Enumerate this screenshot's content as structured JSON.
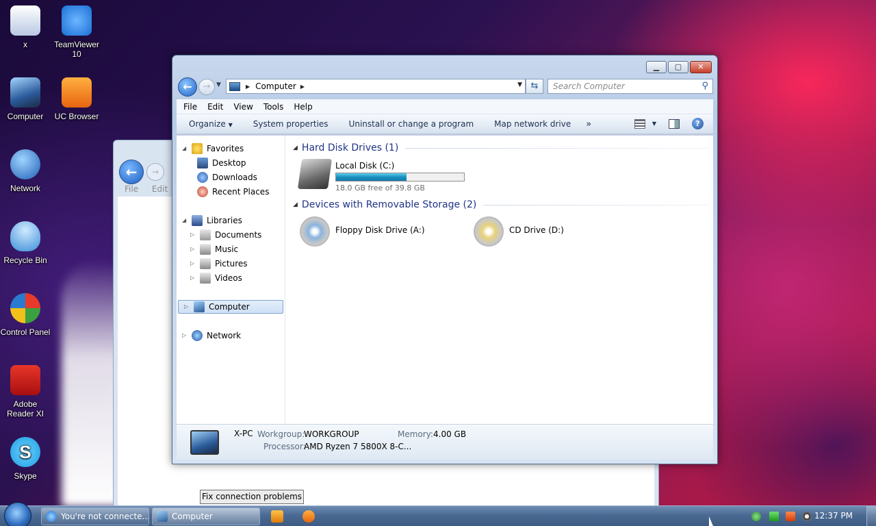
{
  "desktop": {
    "icons": [
      {
        "label": "x",
        "color": "#d5dff0"
      },
      {
        "label": "TeamViewer 10",
        "color": "#1a6fd6"
      },
      {
        "label": "Computer",
        "color": "#3a78c2"
      },
      {
        "label": "UC Browser",
        "color": "#f07a1a"
      },
      {
        "label": "Network",
        "color": "#2a7ad0"
      },
      {
        "label": "Recycle Bin",
        "color": "#5aaee8"
      },
      {
        "label": "Control Panel",
        "color": "#3aa040"
      },
      {
        "label": "Adobe Reader XI",
        "color": "#c41a1a"
      },
      {
        "label": "Skype",
        "color": "#1fa8e8"
      }
    ]
  },
  "background_window": {
    "menu": [
      "File",
      "Edit"
    ],
    "fix_button": "Fix connection problems"
  },
  "window": {
    "address": {
      "location": "Computer"
    },
    "search_placeholder": "Search Computer",
    "menu": [
      "File",
      "Edit",
      "View",
      "Tools",
      "Help"
    ],
    "commands": {
      "organize": "Organize",
      "system_properties": "System properties",
      "uninstall": "Uninstall or change a program",
      "map_drive": "Map network drive",
      "more": "»"
    },
    "nav": {
      "favorites": "Favorites",
      "desktop": "Desktop",
      "downloads": "Downloads",
      "recent": "Recent Places",
      "libraries": "Libraries",
      "documents": "Documents",
      "music": "Music",
      "pictures": "Pictures",
      "videos": "Videos",
      "computer": "Computer",
      "network": "Network"
    },
    "groups": {
      "hdd": "Hard Disk Drives (1)",
      "removable": "Devices with Removable Storage (2)"
    },
    "drives": {
      "local_c": {
        "name": "Local Disk (C:)",
        "free_text": "18.0 GB free of 39.8 GB",
        "used_fraction": 0.55
      },
      "floppy": {
        "name": "Floppy Disk Drive (A:)"
      },
      "cd": {
        "name": "CD Drive (D:)"
      }
    },
    "details": {
      "pc_name": "X-PC",
      "workgroup_label": "Workgroup:",
      "workgroup": "WORKGROUP",
      "memory_label": "Memory:",
      "memory": "4.00 GB",
      "processor_label": "Processor:",
      "processor": "AMD Ryzen 7 5800X 8-C..."
    }
  },
  "taskbar": {
    "tasks": [
      {
        "label": "You're not connecte..."
      },
      {
        "label": "Computer"
      }
    ],
    "clock": "12:37 PM"
  }
}
